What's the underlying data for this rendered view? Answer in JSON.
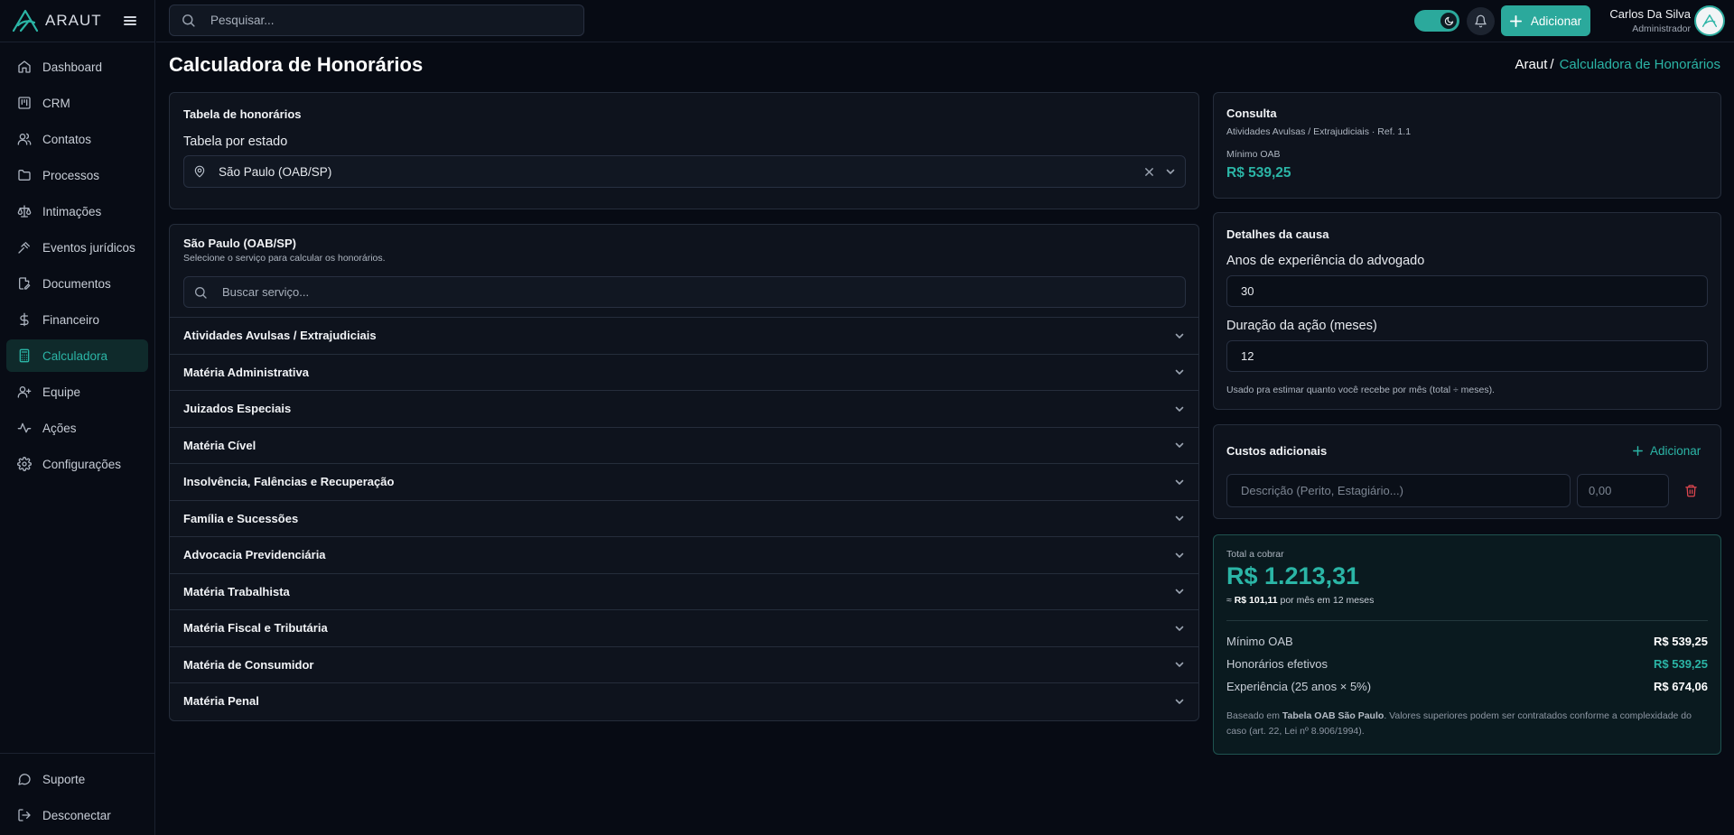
{
  "app": {
    "brand": "ARAUT",
    "logo_icon": "araut-logo-icon",
    "accent_color": "#2bb5a6"
  },
  "sidebar": {
    "items": [
      {
        "label": "Dashboard",
        "icon": "home-icon"
      },
      {
        "label": "CRM",
        "icon": "kanban-icon"
      },
      {
        "label": "Contatos",
        "icon": "users-icon"
      },
      {
        "label": "Processos",
        "icon": "folder-icon"
      },
      {
        "label": "Intimações",
        "icon": "scale-icon"
      },
      {
        "label": "Eventos jurídicos",
        "icon": "gavel-icon"
      },
      {
        "label": "Documentos",
        "icon": "file-edit-icon"
      },
      {
        "label": "Financeiro",
        "icon": "dollar-icon"
      },
      {
        "label": "Calculadora",
        "icon": "calculator-icon",
        "active": true
      },
      {
        "label": "Equipe",
        "icon": "user-plus-icon"
      },
      {
        "label": "Ações",
        "icon": "activity-icon"
      },
      {
        "label": "Configurações",
        "icon": "gear-icon"
      }
    ],
    "bottom": [
      {
        "label": "Suporte",
        "icon": "message-circle-icon"
      },
      {
        "label": "Desconectar",
        "icon": "logout-icon"
      }
    ]
  },
  "topbar": {
    "search_placeholder": "Pesquisar...",
    "add_label": "Adicionar",
    "user_name": "Carlos Da Silva",
    "user_role": "Administrador",
    "theme": "dark"
  },
  "page": {
    "title": "Calculadora de Honorários",
    "breadcrumb_home": "Araut",
    "breadcrumb_sep": "/",
    "breadcrumb_current": "Calculadora de Honorários"
  },
  "table_card": {
    "title": "Tabela de honorários",
    "label": "Tabela por estado",
    "selected": "São Paulo (OAB/SP)"
  },
  "services": {
    "title": "São Paulo (OAB/SP)",
    "subtitle": "Selecione o serviço para calcular os honorários.",
    "search_placeholder": "Buscar serviço...",
    "categories": [
      "Atividades Avulsas / Extrajudiciais",
      "Matéria Administrativa",
      "Juizados Especiais",
      "Matéria Cível",
      "Insolvência, Falências e Recuperação",
      "Família e Sucessões",
      "Advocacia Previdenciária",
      "Matéria Trabalhista",
      "Matéria Fiscal e Tributária",
      "Matéria de Consumidor",
      "Matéria Penal"
    ]
  },
  "consulta": {
    "title": "Consulta",
    "path": "Atividades Avulsas / Extrajudiciais · Ref. 1.1",
    "min_label": "Mínimo OAB",
    "min_value": "R$ 539,25"
  },
  "detalhes": {
    "title": "Detalhes da causa",
    "experience_label": "Anos de experiência do advogado",
    "experience_value": "30",
    "duration_label": "Duração da ação (meses)",
    "duration_value": "12",
    "hint": "Usado pra estimar quanto você recebe por mês (total ÷ meses)."
  },
  "custos": {
    "title": "Custos adicionais",
    "add_label": "Adicionar",
    "desc_placeholder": "Descrição (Perito, Estagiário...)",
    "value_placeholder": "0,00"
  },
  "total": {
    "label": "Total a cobrar",
    "value": "R$ 1.213,31",
    "monthly_prefix": "≈",
    "monthly_value": "R$ 101,11",
    "monthly_suffix": "por mês em 12 meses",
    "rows": [
      {
        "label": "Mínimo OAB",
        "value": "R$ 539,25"
      },
      {
        "label": "Honorários efetivos",
        "value": "R$ 539,25"
      },
      {
        "label": "Experiência (25 anos × 5%)",
        "value": "R$ 674,06"
      }
    ],
    "note_prefix": "Baseado em",
    "note_source": "Tabela OAB São Paulo",
    "note_suffix": ". Valores superiores podem ser contratados conforme a complexidade do caso (art. 22, Lei nº 8.906/1994)."
  }
}
